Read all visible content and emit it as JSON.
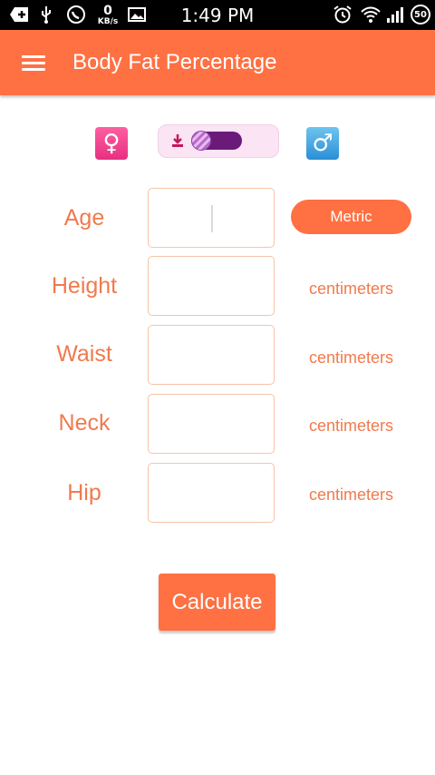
{
  "status_bar": {
    "time": "1:49 PM",
    "net_speed_value": "0",
    "net_speed_unit": "KB/s",
    "battery": "50",
    "icons": [
      "add-icon",
      "usb-icon",
      "whatsapp-icon",
      "image-icon",
      "alarm-icon",
      "wifi-icon",
      "signal-icon",
      "battery-icon"
    ]
  },
  "app_bar": {
    "title": "Body Fat Percentage",
    "menu_icon": "hamburger-menu-icon",
    "color": "#ff7043"
  },
  "gender": {
    "female_symbol": "♀",
    "male_symbol": "♂",
    "toggle_state": "female"
  },
  "form": {
    "rows": [
      {
        "label": "Age",
        "value": "",
        "unit": ""
      },
      {
        "label": "Height",
        "value": "",
        "unit": "centimeters"
      },
      {
        "label": "Waist",
        "value": "",
        "unit": "centimeters"
      },
      {
        "label": "Neck",
        "value": "",
        "unit": "centimeters"
      },
      {
        "label": "Hip",
        "value": "",
        "unit": "centimeters"
      }
    ],
    "unit_system_button": "Metric"
  },
  "calculate_button": "Calculate"
}
